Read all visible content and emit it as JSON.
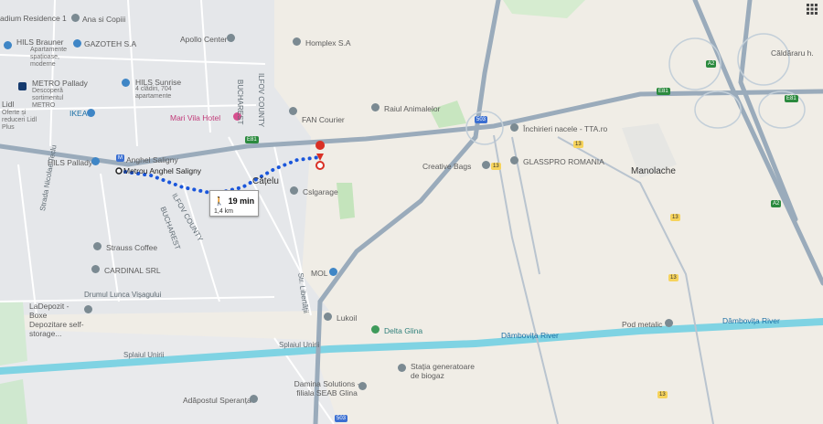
{
  "places": {
    "stadium": "adium Residence 1",
    "ana": "Ana si Copiii",
    "hils_brauner": "HILS Brauner",
    "hils_brauner_sub": "Apartamente spațioase, moderne",
    "gazoteh": "GAZOTEH S.A",
    "apollo": "Apollo Center",
    "homplex": "Homplex S.A",
    "metro_pallady": "METRO Pallady",
    "metro_pallady_sub": "Descoperă sortimentul METRO",
    "hils_sunrise": "HILS Sunrise",
    "hils_sunrise_sub": "4 clădiri, 704 apartamente",
    "ikea": "IKEA",
    "lidl": "Lidl",
    "lidl_sub": "Oferte și reduceri Lidl Plus",
    "mari_vila": "Mari Vila Hotel",
    "fan_courier": "FAN Courier",
    "raiul": "Raiul Animalelor",
    "inchirieri": "Închirieri nacele - TTA.ro",
    "glasspro": "GLASSPRO ROMANIA",
    "creative": "Creative Bags",
    "manolache": "Manolache",
    "caldararu": "Căldăraru h.",
    "anghel": "Anghel Saligny",
    "hils_pallady": "HILS Pallady",
    "metrou": "Metrou Anghel Saligny",
    "catelu": "Cățelu",
    "cslgarage": "Cslgarage",
    "strauss": "Strauss Coffee",
    "cardinal": "CARDINAL SRL",
    "mol": "MOL",
    "lukoil": "Lukoil",
    "delta": "Delta Glina",
    "ladepozit": "LaDepozit - Boxe Depozitare self-storage...",
    "pod": "Pod metalic",
    "dambovita1": "Dâmbovița River",
    "dambovita2": "Dâmbovița River",
    "statia": "Stația generatoare de biogaz",
    "damina": "Damina Solutions - filiala SEAB Glina",
    "adapostul": "Adăpostul Speranța"
  },
  "roads": {
    "bucharest1": "BUCHAREST",
    "ilfov1": "ILFOV COUNTY",
    "bucharest2": "BUCHAREST",
    "ilfov2": "ILFOV COUNTY",
    "nicolae": "Strada Nicolae Teclu",
    "lunca": "Drumul Lunca Vișagului",
    "splaiul1": "Splaiul Unirii",
    "splaiul2": "Splaiul Unirii",
    "libertatii": "Str. Libertății"
  },
  "shields": {
    "e81a": "E81",
    "e81b": "E81",
    "e81c": "E81",
    "a2a": "A2",
    "a2b": "A2",
    "r13a": "13",
    "r13b": "13",
    "r13c": "13",
    "r13d": "13",
    "r13e": "13",
    "r503a": "503",
    "r503b": "503",
    "m": "M"
  },
  "route": {
    "duration": "19 min",
    "distance": "1,4 km"
  },
  "colors": {
    "land": "#f0ede6",
    "city": "#e6e8ea",
    "river": "#7fd3e3",
    "highway": "#8ea2b4",
    "route": "#1a56db",
    "green": "#c8e6c0",
    "destination": "#d93025"
  }
}
